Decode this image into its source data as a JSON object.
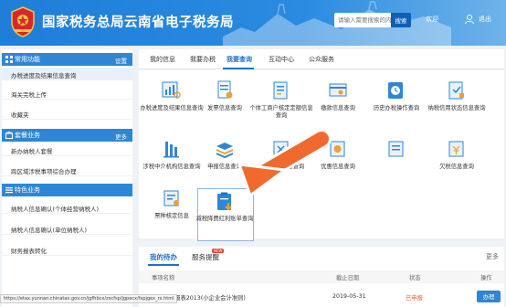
{
  "header": {
    "title": "国家税务总局云南省电子税务局",
    "search_placeholder": "请输入需要搜索的内容",
    "search_button": "搜索",
    "welcome": "欢迎",
    "logout": "退出"
  },
  "sidebar": {
    "sections": [
      {
        "title": "常用功能",
        "action": "设置",
        "items": [
          "办税进度及结果信息查询",
          "海关完税上传",
          "收藏夹"
        ]
      },
      {
        "title": "套餐业务",
        "action": "更多",
        "items": [
          "新办纳税人套餐",
          "跨区域涉税事项综合办理"
        ]
      },
      {
        "title": "特色业务",
        "action": "",
        "items": [
          "纳税人信息确认(个体经营纳税人)",
          "纳税人信息确认(单位纳税人)",
          "财务报表转化"
        ]
      }
    ]
  },
  "main": {
    "tabs": [
      "我的信息",
      "我要办税",
      "我要查询",
      "互动中心",
      "公众服务"
    ],
    "active_tab": "我要查询",
    "tiles_row1": [
      "办税进度及结果信息查询",
      "发票信息查询",
      "个体工商户核定定额信息查询",
      "缴款信息查询",
      "历史办税操作查询",
      "纳税信用状态信息查询"
    ],
    "tiles_row2": [
      "涉税中介机构信息查询",
      "申报信息查询",
      "违法违章信息查询",
      "优惠信息查询",
      "",
      "欠税信息查询"
    ],
    "tiles_row3": [
      "票种核定信息",
      "减税降费红利账单查询"
    ]
  },
  "todo": {
    "tabs": [
      "我的待办",
      "服务提醒"
    ],
    "badge": "NEW",
    "more": "更多",
    "columns": [
      "事项名称",
      "截止日期",
      "状态",
      "操作"
    ],
    "rows": [
      {
        "name": "年度财务报表2013(小企业会计准则)",
        "deadline": "2019-05-31",
        "status": "已申报",
        "action": "办理"
      }
    ]
  },
  "status_url": "https://etax.yunnan.chinatax.gov.cn/jgfhbcx/zxcfsp/jgpecx/fxpjgex_rx.html",
  "colors": {
    "header_blue": "#2a8be0",
    "section_blue": "#2f86d6",
    "arrow_orange": "#f06a30",
    "active_tab": "#1f6fd0"
  }
}
